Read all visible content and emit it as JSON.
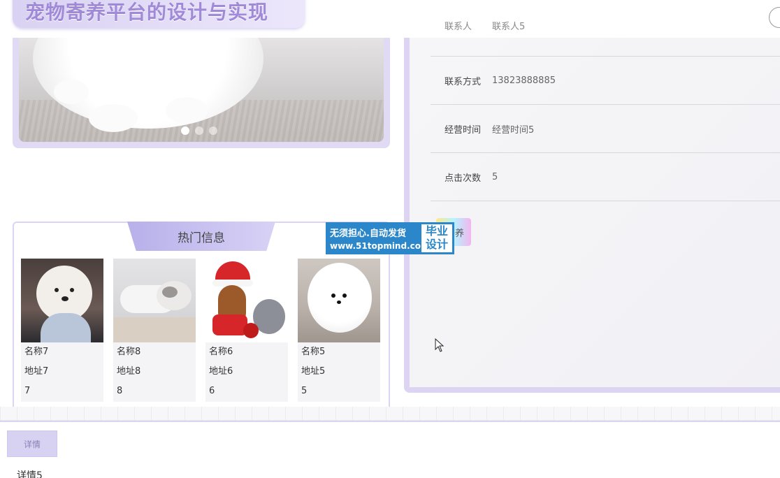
{
  "header": {
    "title": "宠物寄养平台的设计与实现"
  },
  "carousel": {
    "slide_count": 3,
    "active_index": 0
  },
  "details": {
    "rows": [
      {
        "label": "联系人",
        "value": "联系人5"
      },
      {
        "label": "联系方式",
        "value": "13823888885"
      },
      {
        "label": "经营时间",
        "value": "经营时间5"
      },
      {
        "label": "点击次数",
        "value": "5"
      }
    ],
    "action_label": "寄养"
  },
  "hot": {
    "title": "热门信息",
    "items": [
      {
        "name": "名称7",
        "address": "地址7",
        "count": "7"
      },
      {
        "name": "名称8",
        "address": "地址8",
        "count": "8"
      },
      {
        "name": "名称6",
        "address": "地址6",
        "count": "6"
      },
      {
        "name": "名称5",
        "address": "地址5",
        "count": "5"
      }
    ]
  },
  "watermark": {
    "line1": "无须担心.自动发货",
    "line2": "www.51topmind.com",
    "badge": "毕业设计"
  },
  "bottom": {
    "tab_label": "详情",
    "content": "详情5"
  },
  "colors": {
    "accent": "#dcd4f2",
    "title": "#a08ad8",
    "watermark": "#2b87c9"
  }
}
